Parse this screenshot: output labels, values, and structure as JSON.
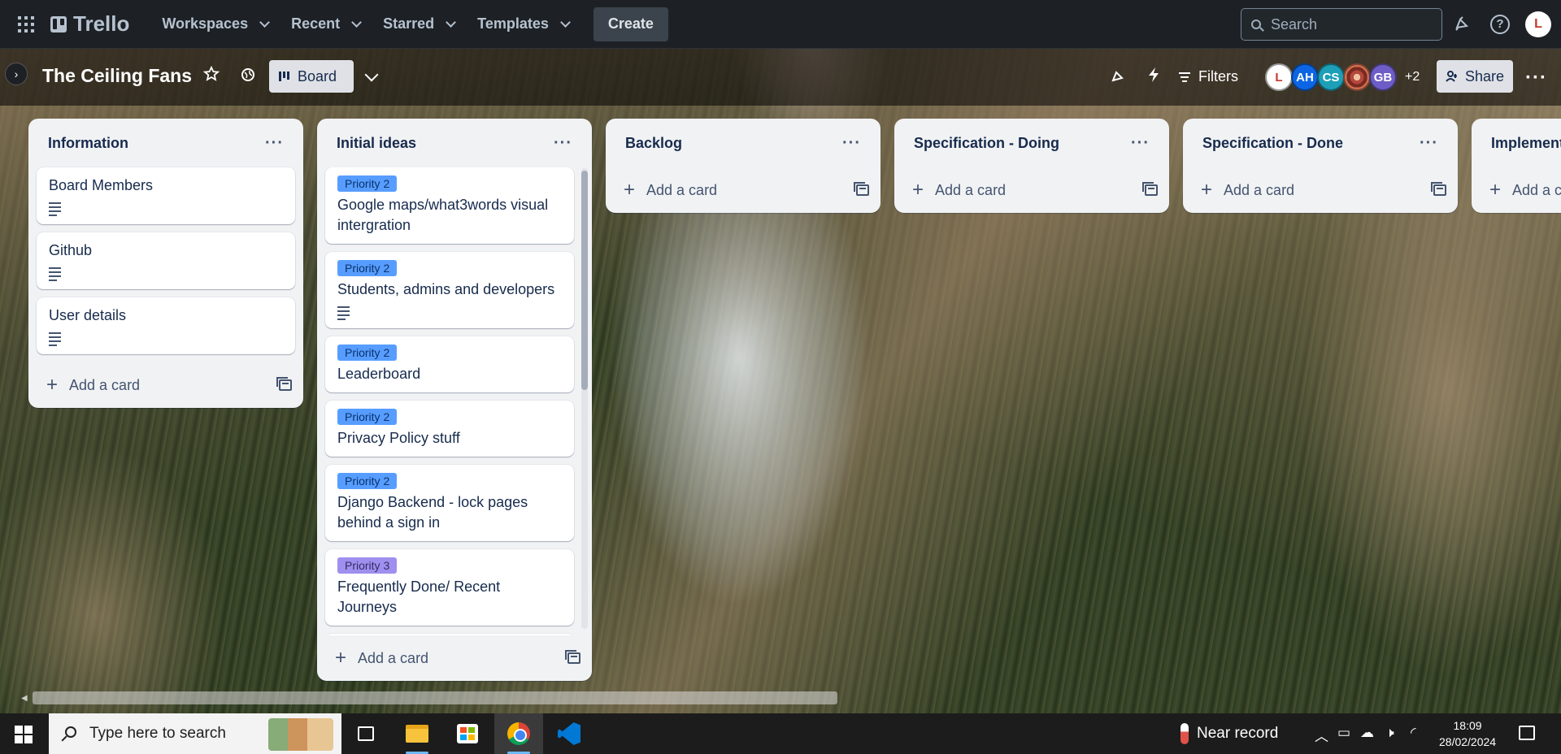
{
  "topnav": {
    "logo": "Trello",
    "menus": [
      "Workspaces",
      "Recent",
      "Starred",
      "Templates"
    ],
    "create_label": "Create",
    "search_placeholder": "Search",
    "user_initial": "L"
  },
  "board": {
    "title": "The Ceiling Fans",
    "view_label": "Board",
    "filters_label": "Filters",
    "members": [
      {
        "initials": "L",
        "color": "#ffffff"
      },
      {
        "initials": "AH",
        "color": "#0c66e4"
      },
      {
        "initials": "CS",
        "color": "#1d9fb8"
      },
      {
        "initials": "",
        "color": "#b5483c"
      },
      {
        "initials": "GB",
        "color": "#6e5dc6"
      }
    ],
    "extra_members": "+2",
    "share_label": "Share"
  },
  "lists": [
    {
      "title": "Information",
      "cards": [
        {
          "text": "Board Members",
          "has_description": true
        },
        {
          "text": "Github",
          "has_description": true
        },
        {
          "text": "User details",
          "has_description": true
        }
      ],
      "add_label": "Add a card"
    },
    {
      "title": "Initial ideas",
      "cards": [
        {
          "label": "Priority 2",
          "text": "Google maps/what3words visual intergration"
        },
        {
          "label": "Priority 2",
          "text": "Students, admins and developers",
          "has_description": true
        },
        {
          "label": "Priority 2",
          "text": "Leaderboard"
        },
        {
          "label": "Priority 2",
          "text": "Privacy Policy stuff"
        },
        {
          "label": "Priority 2",
          "text": "Django Backend - lock pages behind a sign in"
        },
        {
          "label": "Priority 3",
          "text": "Frequently Done/ Recent Journeys"
        }
      ],
      "add_label": "Add a card"
    },
    {
      "title": "Backlog",
      "cards": [],
      "add_label": "Add a card"
    },
    {
      "title": "Specification - Doing",
      "cards": [],
      "add_label": "Add a card"
    },
    {
      "title": "Specification - Done",
      "cards": [],
      "add_label": "Add a card"
    },
    {
      "title": "Implement",
      "cards": [],
      "add_label": "Add a c"
    }
  ],
  "taskbar": {
    "search_placeholder": "Type here to search",
    "weather": "Near record",
    "time": "18:09",
    "date": "28/02/2024"
  }
}
